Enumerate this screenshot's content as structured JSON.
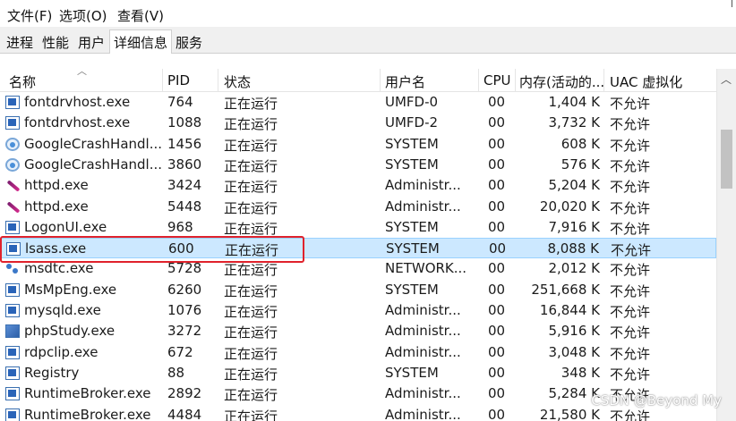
{
  "menu": [
    "文件(F)",
    "选项(O)",
    "查看(V)"
  ],
  "tabs": [
    "进程",
    "性能",
    "用户",
    "详细信息",
    "服务"
  ],
  "active_tab_index": 3,
  "columns": {
    "name": "名称",
    "pid": "PID",
    "status": "状态",
    "user": "用户名",
    "cpu": "CPU",
    "memory": "内存(活动的...",
    "uac": "UAC 虚拟化"
  },
  "rows": [
    {
      "icon": "window-icon",
      "name": "fontdrvhost.exe",
      "pid": "764",
      "status": "正在运行",
      "user": "UMFD-0",
      "cpu": "00",
      "memory": "1,404 K",
      "uac": "不允许"
    },
    {
      "icon": "window-icon",
      "name": "fontdrvhost.exe",
      "pid": "1088",
      "status": "正在运行",
      "user": "UMFD-2",
      "cpu": "00",
      "memory": "3,732 K",
      "uac": "不允许"
    },
    {
      "icon": "google-crash-icon",
      "name": "GoogleCrashHandl...",
      "pid": "1456",
      "status": "正在运行",
      "user": "SYSTEM",
      "cpu": "00",
      "memory": "608 K",
      "uac": "不允许"
    },
    {
      "icon": "google-crash-icon",
      "name": "GoogleCrashHandl...",
      "pid": "3860",
      "status": "正在运行",
      "user": "SYSTEM",
      "cpu": "00",
      "memory": "576 K",
      "uac": "不允许"
    },
    {
      "icon": "feather-icon",
      "name": "httpd.exe",
      "pid": "3424",
      "status": "正在运行",
      "user": "Administr...",
      "cpu": "00",
      "memory": "5,204 K",
      "uac": "不允许"
    },
    {
      "icon": "feather-icon",
      "name": "httpd.exe",
      "pid": "5448",
      "status": "正在运行",
      "user": "Administr...",
      "cpu": "00",
      "memory": "20,020 K",
      "uac": "不允许"
    },
    {
      "icon": "window-icon",
      "name": "LogonUI.exe",
      "pid": "968",
      "status": "正在运行",
      "user": "SYSTEM",
      "cpu": "00",
      "memory": "7,916 K",
      "uac": "不允许"
    },
    {
      "icon": "window-icon",
      "name": "lsass.exe",
      "pid": "600",
      "status": "正在运行",
      "user": "SYSTEM",
      "cpu": "00",
      "memory": "8,088 K",
      "uac": "不允许",
      "selected": true
    },
    {
      "icon": "network-icon",
      "name": "msdtc.exe",
      "pid": "5728",
      "status": "正在运行",
      "user": "NETWORK...",
      "cpu": "00",
      "memory": "2,012 K",
      "uac": "不允许"
    },
    {
      "icon": "window-icon",
      "name": "MsMpEng.exe",
      "pid": "6260",
      "status": "正在运行",
      "user": "SYSTEM",
      "cpu": "00",
      "memory": "251,668 K",
      "uac": "不允许"
    },
    {
      "icon": "window-icon",
      "name": "mysqld.exe",
      "pid": "1076",
      "status": "正在运行",
      "user": "Administr...",
      "cpu": "00",
      "memory": "16,844 K",
      "uac": "不允许"
    },
    {
      "icon": "phpstudy-icon",
      "name": "phpStudy.exe",
      "pid": "3272",
      "status": "正在运行",
      "user": "Administr...",
      "cpu": "00",
      "memory": "5,916 K",
      "uac": "不允许"
    },
    {
      "icon": "window-icon",
      "name": "rdpclip.exe",
      "pid": "672",
      "status": "正在运行",
      "user": "Administr...",
      "cpu": "00",
      "memory": "3,048 K",
      "uac": "不允许"
    },
    {
      "icon": "window-icon",
      "name": "Registry",
      "pid": "88",
      "status": "正在运行",
      "user": "SYSTEM",
      "cpu": "00",
      "memory": "348 K",
      "uac": "不允许"
    },
    {
      "icon": "window-icon",
      "name": "RuntimeBroker.exe",
      "pid": "2892",
      "status": "正在运行",
      "user": "Administr...",
      "cpu": "00",
      "memory": "5,284 K",
      "uac": "不允许"
    },
    {
      "icon": "window-icon",
      "name": "RuntimeBroker.exe",
      "pid": "4484",
      "status": "正在运行",
      "user": "Administr...",
      "cpu": "00",
      "memory": "21,580 K",
      "uac": "不允许"
    }
  ],
  "watermark": "CSDN @Beyond My",
  "colors": {
    "selection_bg": "#cce8ff",
    "selection_border": "#99d1ff",
    "highlight_border": "#e0222c"
  }
}
